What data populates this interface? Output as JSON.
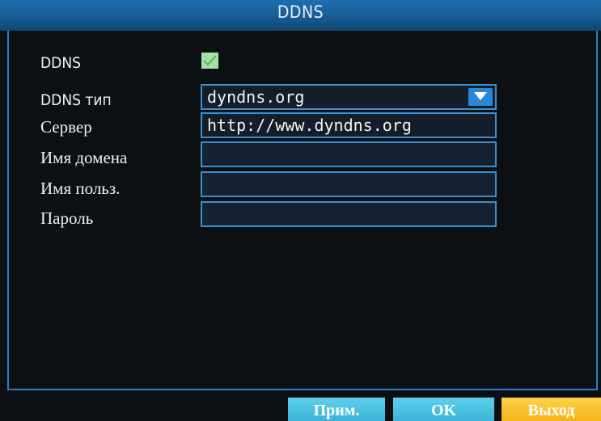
{
  "window": {
    "title": "DDNS"
  },
  "form": {
    "ddns_label": "DDNS",
    "ddns_enabled": true,
    "type_label": "DDNS тип",
    "type_value": "dyndns.org",
    "server_label": "Сервер",
    "server_value": "http://www.dyndns.org",
    "domain_label": "Имя домена",
    "domain_value": "",
    "user_label": "Имя польз.",
    "user_value": "",
    "password_label": "Пароль",
    "password_value": ""
  },
  "buttons": {
    "apply_label": "Прим.",
    "ok_label": "OK",
    "exit_label": "Выход"
  },
  "colors": {
    "title_bar": "#1d6fb0",
    "frame_border": "#2a7fc6",
    "field_border": "#3a8fd2",
    "checkbox_on": "#9fe09f",
    "button_primary": "#4cc2e0",
    "button_exit": "#f7c230"
  },
  "icons": {
    "checkbox": "checkmark-icon",
    "dropdown": "triangle-down-icon"
  }
}
